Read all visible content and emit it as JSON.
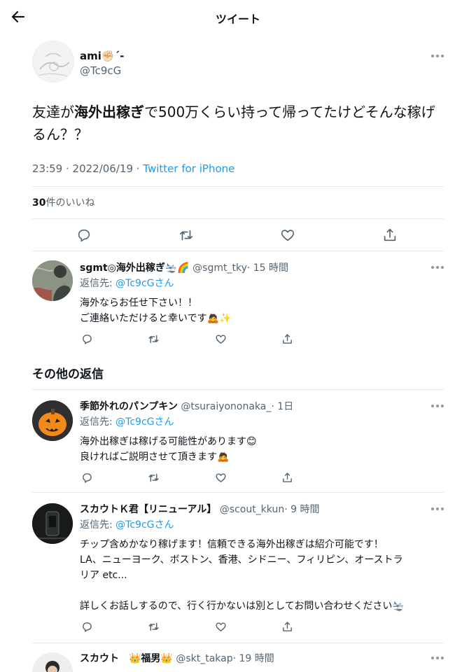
{
  "header": {
    "title": "ツイート"
  },
  "main_tweet": {
    "name": "ami✊🏻ˊ-",
    "handle": "@Tc9cG",
    "text_before": "友達が",
    "text_bold": "海外出稼ぎ",
    "text_after": "で500万くらい持って帰ってたけどそんな稼げるん？？",
    "timestamp": "23:59 · 2022/06/19 · ",
    "source": "Twitter for iPhone",
    "likes_count": "30",
    "likes_label": "件のいいね"
  },
  "replies": [
    {
      "name": "sgmt◎海外出稼ぎ🛬🌈",
      "handle": "@sgmt_tky",
      "time": "· 15 時間",
      "reply_prefix": "返信先: ",
      "reply_handle": "@Tc9cGさん",
      "line1": "海外ならお任せ下さい！！",
      "line2": "ご連絡いただけると幸いです🙇✨"
    },
    {
      "name": "季節外れのパンプキン",
      "handle": "@tsuraiyononaka_",
      "time": "· 1日",
      "reply_prefix": "返信先: ",
      "reply_handle": "@Tc9cGさん",
      "line1": "海外出稼ぎは稼げる可能性があります😊",
      "line2": "良ければご説明させて頂きます🙇"
    },
    {
      "name": "スカウトＫ君【リニューアル】",
      "handle": "@scout_kkun",
      "time": "· 9 時間",
      "reply_prefix": "返信先: ",
      "reply_handle": "@Tc9cGさん",
      "line1": "チップ含めかなり稼げます！信頼できる海外出稼ぎは紹介可能です！",
      "line2": "LA、ニューヨーク、ボストン、香港、シドニー、フィリピン、オーストラ",
      "line3": "リア etc...",
      "line4": "詳しくお話しするので、行く行かないは別としてお問い合わせください🛬"
    },
    {
      "name": "スカウト　👑福男👑",
      "handle": "@skt_takap",
      "time": "· 19 時間"
    }
  ],
  "other_replies_title": "その他の返信",
  "colors": {
    "accent": "#1d9bf0",
    "muted": "#536471",
    "divider": "#e7e9ea"
  },
  "icons": [
    "back-arrow-icon",
    "more-icon",
    "reply-icon",
    "retweet-icon",
    "like-icon",
    "share-icon"
  ]
}
